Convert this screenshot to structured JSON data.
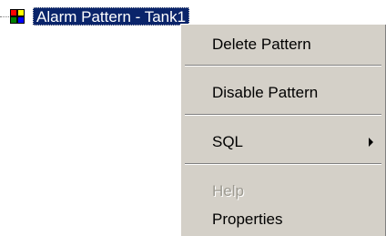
{
  "tree": {
    "selected_node_label": "Alarm Pattern - Tank1",
    "node_icon": "alarm-pattern-icon"
  },
  "context_menu": {
    "items": [
      {
        "label": "Delete Pattern",
        "enabled": true
      },
      {
        "label": "Disable Pattern",
        "enabled": true
      },
      {
        "label": "SQL",
        "enabled": true,
        "has_submenu": true
      },
      {
        "label": "Help",
        "enabled": false
      },
      {
        "label": "Properties",
        "enabled": true
      }
    ]
  },
  "colors": {
    "selection_background": "#0a246a",
    "menu_background": "#d4d0c8",
    "disabled_text": "#9d9a91"
  }
}
